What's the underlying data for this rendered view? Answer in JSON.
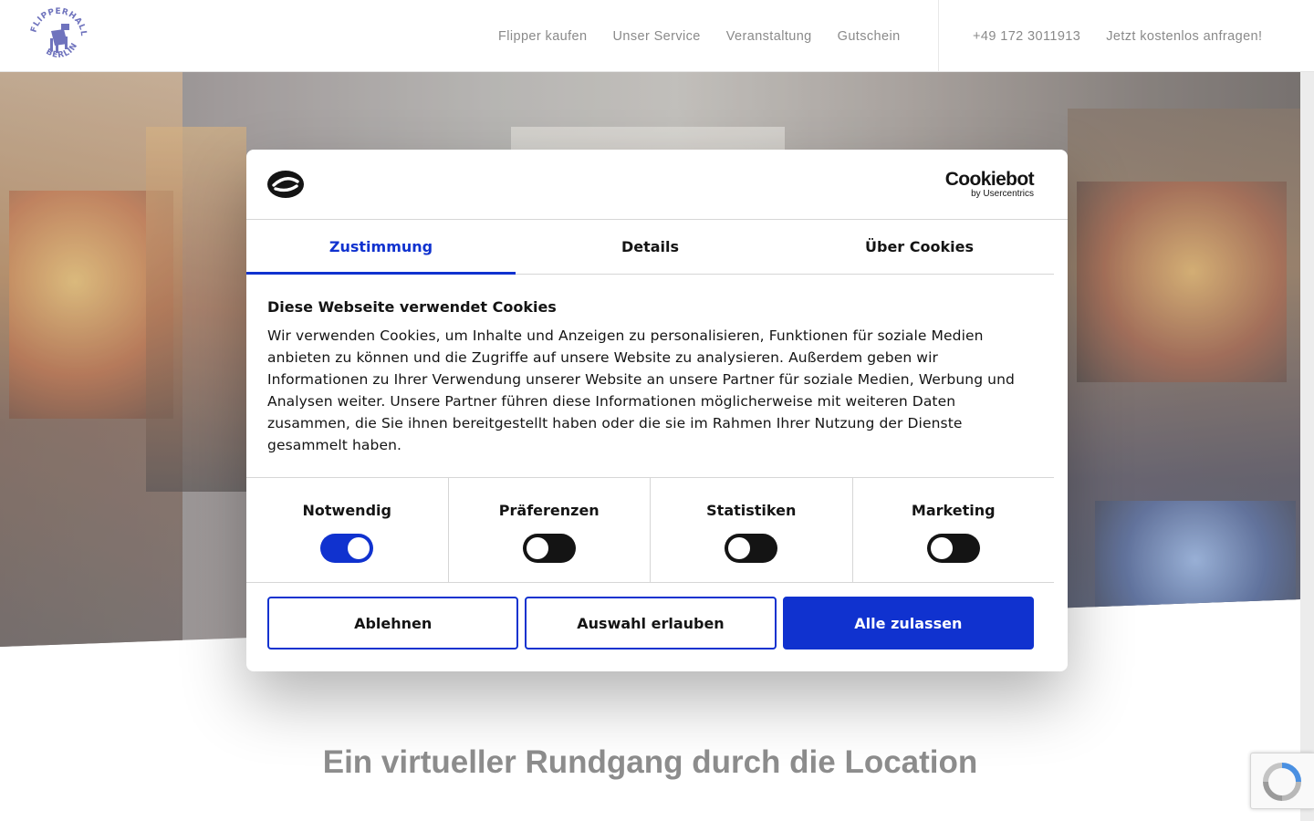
{
  "header": {
    "logo_text": "FLIPPERHALLE BERLIN",
    "nav": [
      "Flipper kaufen",
      "Unser Service",
      "Veranstaltung",
      "Gutschein"
    ],
    "phone": "+49 172 3011913",
    "cta": "Jetzt kostenlos anfragen!"
  },
  "main": {
    "headline": "Ein virtueller Rundgang durch die Location"
  },
  "cookie_dialog": {
    "brand": "Cookiebot",
    "brand_sub": "by Usercentrics",
    "tabs": [
      {
        "label": "Zustimmung",
        "active": true
      },
      {
        "label": "Details",
        "active": false
      },
      {
        "label": "Über Cookies",
        "active": false
      }
    ],
    "title": "Diese Webseite verwendet Cookies",
    "text": "Wir verwenden Cookies, um Inhalte und Anzeigen zu personalisieren, Funktionen für soziale Medien anbieten zu können und die Zugriffe auf unsere Website zu analysieren. Außerdem geben wir Informationen zu Ihrer Verwendung unserer Website an unsere Partner für soziale Medien, Werbung und Analysen weiter. Unsere Partner führen diese Informationen möglicherweise mit weiteren Daten zusammen, die Sie ihnen bereitgestellt haben oder die sie im Rahmen Ihrer Nutzung der Dienste gesammelt haben.",
    "categories": [
      {
        "label": "Notwendig",
        "enabled": true
      },
      {
        "label": "Präferenzen",
        "enabled": false
      },
      {
        "label": "Statistiken",
        "enabled": false
      },
      {
        "label": "Marketing",
        "enabled": false
      }
    ],
    "buttons": {
      "decline": "Ablehnen",
      "allow_selection": "Auswahl erlauben",
      "allow_all": "Alle zulassen"
    }
  },
  "colors": {
    "accent": "#1032cf",
    "nav_text": "#8a8a8a",
    "dark": "#141414"
  }
}
